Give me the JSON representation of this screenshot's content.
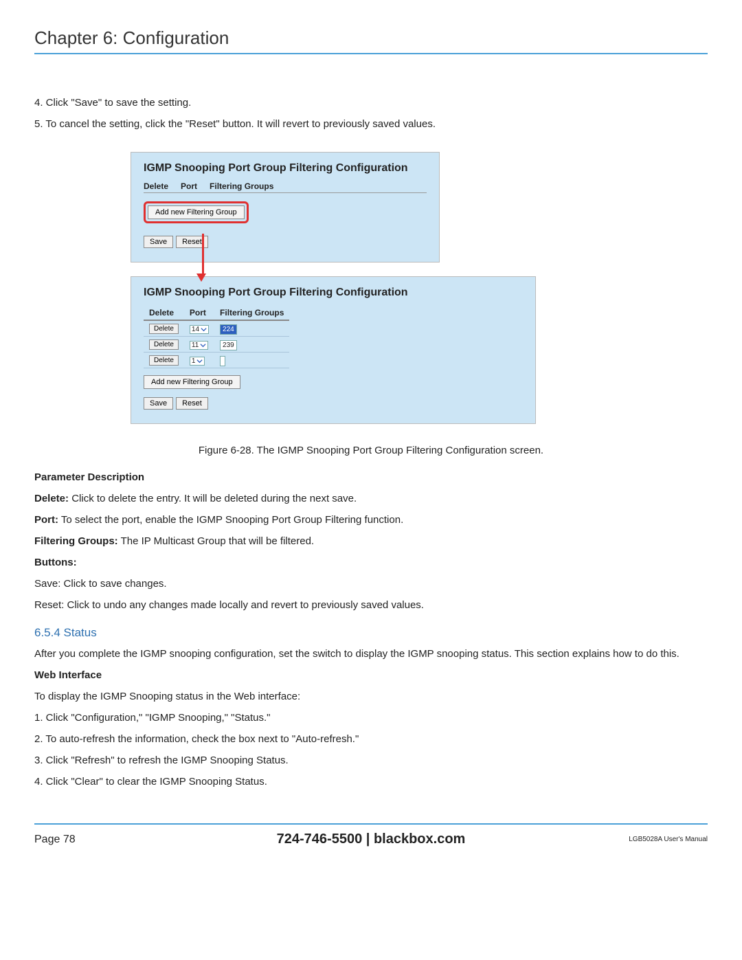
{
  "chapter_title": "Chapter 6: Configuration",
  "intro_steps": {
    "s4": "4. Click \"Save\" to save the setting.",
    "s5": "5. To cancel the setting, click the \"Reset\" button. It will revert to previously saved values."
  },
  "panel_top": {
    "title": "IGMP Snooping Port Group Filtering Configuration",
    "headers": {
      "delete": "Delete",
      "port": "Port",
      "groups": "Filtering Groups"
    },
    "add_btn": "Add new Filtering Group",
    "save_btn": "Save",
    "reset_btn": "Reset"
  },
  "panel_bottom": {
    "title": "IGMP Snooping Port Group Filtering Configuration",
    "headers": {
      "delete": "Delete",
      "port": "Port",
      "groups": "Filtering Groups"
    },
    "rows": [
      {
        "delete": "Delete",
        "port": "14",
        "group": "224",
        "selected": true
      },
      {
        "delete": "Delete",
        "port": "11",
        "group": "239",
        "selected": false
      },
      {
        "delete": "Delete",
        "port": "1",
        "group": "",
        "selected": false
      }
    ],
    "add_btn": "Add new Filtering Group",
    "save_btn": "Save",
    "reset_btn": "Reset"
  },
  "caption": "Figure 6-28. The IGMP Snooping Port Group Filtering Configuration screen.",
  "param_heading": "Parameter Description",
  "params": {
    "delete_label": "Delete:",
    "delete_text": " Click to delete the entry. It will be deleted during the next save.",
    "port_label": "Port:",
    "port_text": " To select the port, enable the IGMP Snooping Port Group Filtering function.",
    "groups_label": "Filtering Groups:",
    "groups_text": " The IP Multicast Group that will be filtered."
  },
  "buttons_heading": "Buttons:",
  "buttons": {
    "save": "Save: Click to save changes.",
    "reset": "Reset: Click to undo any changes made locally and revert to previously saved values."
  },
  "status_section": {
    "heading": "6.5.4 Status",
    "intro": "After you complete the IGMP snooping configuration, set the switch to display the IGMP snooping status. This section explains how to do this.",
    "web_heading": "Web Interface",
    "web_intro": "To display the IGMP Snooping status in the Web interface:",
    "steps": {
      "s1": "1. Click \"Configuration,\" \"IGMP Snooping,\" \"Status.\"",
      "s2": "2. To auto-refresh the information, check the box next to \"Auto-refresh.\"",
      "s3": "3. Click \"Refresh\" to refresh the IGMP Snooping Status.",
      "s4": "4. Click \"Clear\" to clear the IGMP Snooping Status."
    }
  },
  "footer": {
    "page": "Page 78",
    "phone": "724-746-5500",
    "sep": "   |   ",
    "site": "blackbox.com",
    "doc": "LGB5028A User's Manual"
  }
}
